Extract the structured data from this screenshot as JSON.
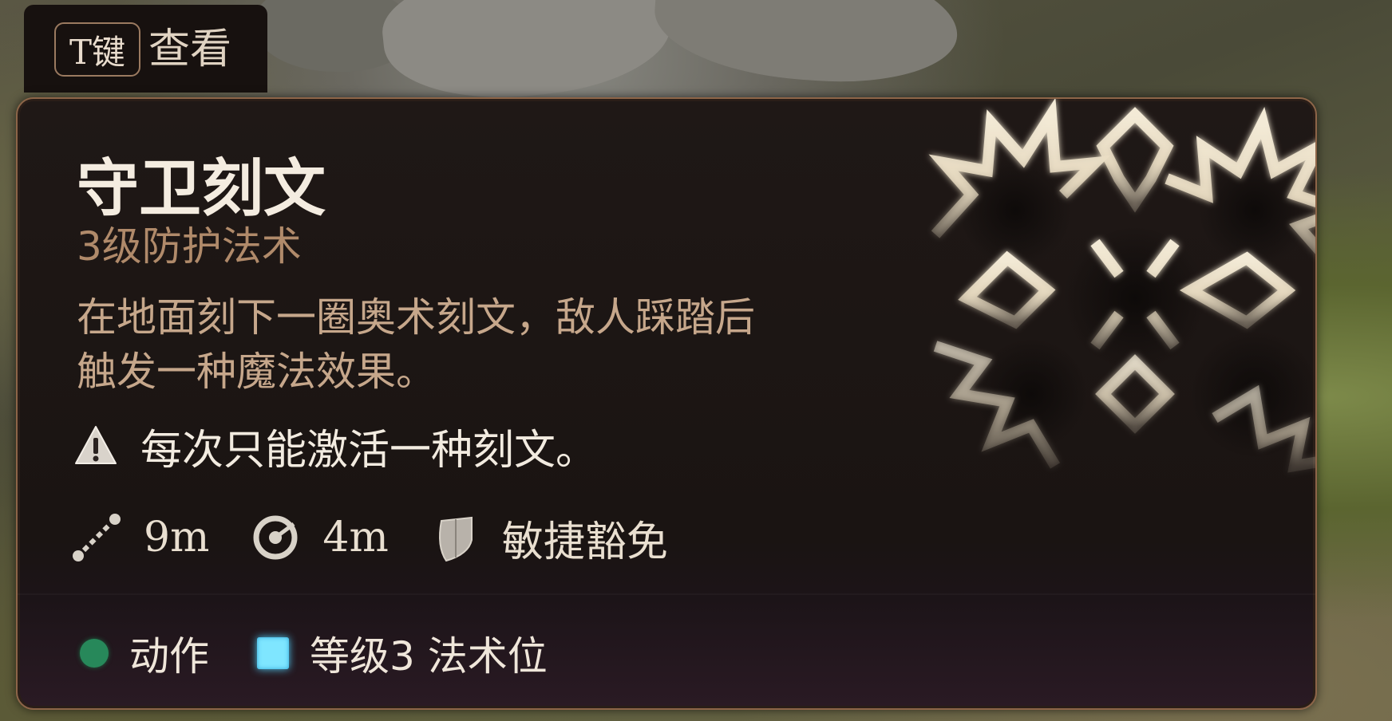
{
  "hint": {
    "key": "T键",
    "label": "查看"
  },
  "spell": {
    "name": "守卫刻文",
    "level": "3级防护法术",
    "description_line1": "在地面刻下一圈奥术刻文，敌人踩踏后",
    "description_line2": "触发一种魔法效果。",
    "warning": "每次只能激活一种刻文。"
  },
  "stats": {
    "range": "9m",
    "radius": "4m",
    "save": "敏捷豁免"
  },
  "costs": {
    "action": "动作",
    "slot": "等级3 法术位"
  },
  "icons": {
    "warning": "warning-triangle-icon",
    "range": "range-dotted-line-icon",
    "radius": "aoe-radius-icon",
    "save": "shield-save-icon",
    "action": "action-dot-icon",
    "slot": "spell-slot-icon",
    "spell_art": "glyph-of-warding-art"
  },
  "colors": {
    "title": "#f4ece0",
    "subtitle": "#b08a6a",
    "description": "#c6a78b",
    "border": "#8d6548",
    "action": "#27885a",
    "spell_slot": "#7fe6ff"
  }
}
